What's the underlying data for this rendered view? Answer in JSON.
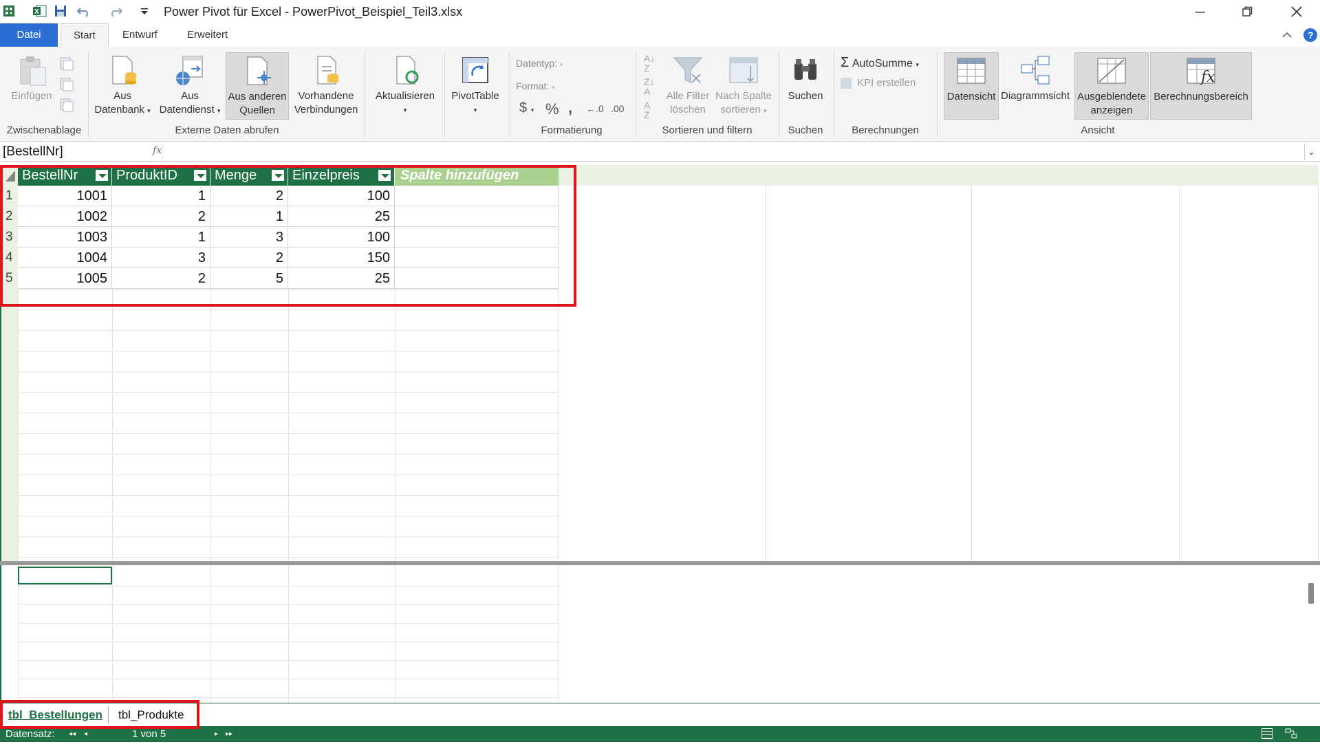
{
  "window": {
    "title": "Power Pivot für Excel - PowerPivot_Beispiel_Teil3.xlsx",
    "minimize_icon": "minimize-icon",
    "restore_icon": "restore-icon",
    "close_icon": "close-icon"
  },
  "quick_access": [
    "powerpivot-logo-icon",
    "excel-icon",
    "save-icon",
    "undo-icon",
    "redo-icon",
    "customize-icon"
  ],
  "tabs": [
    {
      "label": "Datei"
    },
    {
      "label": "Start"
    },
    {
      "label": "Entwurf"
    },
    {
      "label": "Erweitert"
    }
  ],
  "ribbon": {
    "clipboard": {
      "paste": "Einfügen",
      "group": "Zwischenablage"
    },
    "external": {
      "from_db_1": "Aus",
      "from_db_2": "Datenbank",
      "from_service_1": "Aus",
      "from_service_2": "Datendienst",
      "other_1": "Aus anderen",
      "other_2": "Quellen",
      "existing_1": "Vorhandene",
      "existing_2": "Verbindungen",
      "group": "Externe Daten abrufen"
    },
    "refresh": "Aktualisieren",
    "pivot": "PivotTable",
    "formatting": {
      "datatype": "Datentyp:",
      "format": "Format:",
      "currency": "$",
      "percent": "%",
      "thousands": ",",
      "inc_decimal": "←.0",
      "dec_decimal": ".00",
      "group": "Formatierung"
    },
    "sort": {
      "clear_1": "Alle Filter",
      "clear_2": "löschen",
      "bycol_1": "Nach Spalte",
      "bycol_2": "sortieren",
      "group": "Sortieren und filtern"
    },
    "search": {
      "label": "Suchen",
      "group": "Suchen"
    },
    "calc": {
      "autosum": "AutoSumme",
      "kpi": "KPI erstellen",
      "group": "Berechnungen"
    },
    "view": {
      "data": "Datensicht",
      "diagram": "Diagrammsicht",
      "hidden_1": "Ausgeblendete",
      "hidden_2": "anzeigen",
      "calcarea": "Berechnungsbereich",
      "group": "Ansicht"
    }
  },
  "formula_bar": {
    "name_box": "[BestellNr]",
    "fx": "fx"
  },
  "table": {
    "columns": [
      "BestellNr",
      "ProduktID",
      "Menge",
      "Einzelpreis"
    ],
    "add_column": "Spalte hinzufügen",
    "rows": [
      {
        "num": "1",
        "cells": [
          "1001",
          "1",
          "2",
          "100"
        ]
      },
      {
        "num": "2",
        "cells": [
          "1002",
          "2",
          "1",
          "25"
        ]
      },
      {
        "num": "3",
        "cells": [
          "1003",
          "1",
          "3",
          "100"
        ]
      },
      {
        "num": "4",
        "cells": [
          "1004",
          "3",
          "2",
          "150"
        ]
      },
      {
        "num": "5",
        "cells": [
          "1005",
          "2",
          "5",
          "25"
        ]
      }
    ]
  },
  "sheet_tabs": [
    "tbl_Bestellungen",
    "tbl_Produkte"
  ],
  "status": {
    "record_label": "Datensatz:",
    "record_value": "1 von 5"
  }
}
